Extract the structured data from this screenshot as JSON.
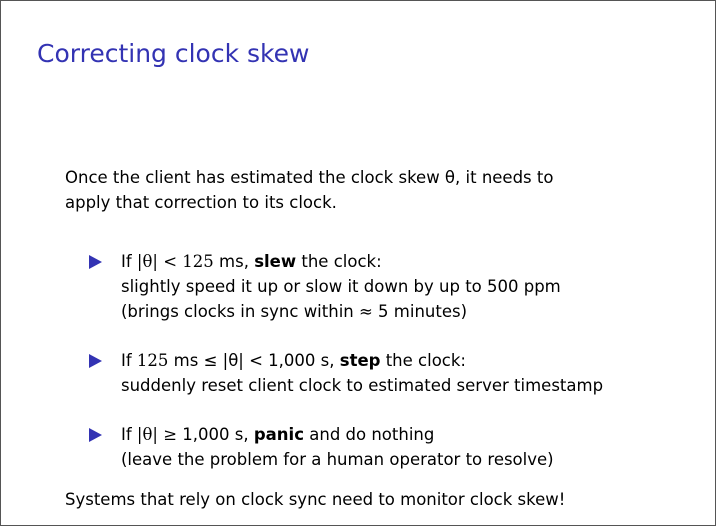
{
  "slide": {
    "title": "Correcting clock skew",
    "intro_line1": "Once the client has estimated the clock skew θ, it needs to",
    "intro_line2": "apply that correction to its clock.",
    "bullets": [
      {
        "prefix": "If ",
        "condition": "|θ| < 125",
        "middle": " ms, ",
        "keyword": "slew",
        "suffix": " the clock:",
        "line2": "slightly speed it up or slow it down by up to 500 ppm",
        "line3": "(brings clocks in sync within ≈ 5 minutes)"
      },
      {
        "prefix": "If ",
        "condition": "125",
        "middle": " ms ≤ |θ| < 1,000 s, ",
        "keyword": "step",
        "suffix": " the clock:",
        "line2": "suddenly reset client clock to estimated server timestamp"
      },
      {
        "prefix": "If ",
        "condition": "|θ| ≥",
        "middle": " 1,000 s, ",
        "keyword": "panic",
        "suffix": " and do nothing",
        "line2": "(leave the problem for a human operator to resolve)"
      }
    ],
    "closing": "Systems that rely on clock sync need to monitor clock skew!"
  },
  "colors": {
    "title": "#3333b3",
    "bullet_marker": "#3333b3",
    "text": "#000000",
    "frame_border": "#555555"
  }
}
